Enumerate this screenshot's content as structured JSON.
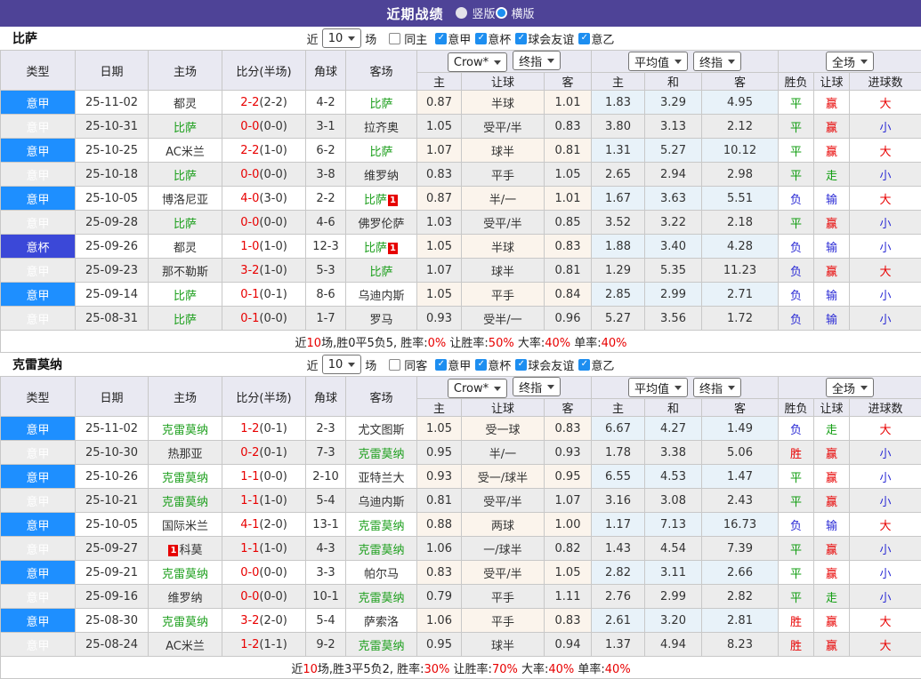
{
  "titlebar": {
    "title": "近期战绩",
    "radios": [
      {
        "label": "竖版",
        "selected": false
      },
      {
        "label": "横版",
        "selected": true
      }
    ]
  },
  "filters_common": {
    "near": "近",
    "count": "10",
    "games": "场",
    "leagues": [
      "意甲",
      "意杯",
      "球会友谊",
      "意乙"
    ]
  },
  "table_header": {
    "type": "类型",
    "date": "日期",
    "home": "主场",
    "score": "比分(半场)",
    "corner": "角球",
    "away": "客场",
    "book_select": "Crow*",
    "final_select": "终指",
    "avg_select": "平均值",
    "full_select": "全场",
    "sub_home": "主",
    "sub_handicap": "让球",
    "sub_away": "客",
    "sub_avg_home": "主",
    "sub_avg_draw": "和",
    "sub_avg_away": "客",
    "sub_wdl": "胜负",
    "sub_let": "让球",
    "sub_goals": "进球数"
  },
  "colors": {
    "topbar_purple": "#4e4397",
    "league_blue": "#1e8fff",
    "cup_blue": "#3b48d8",
    "subject_green": "#1fa01f",
    "win_red": "#e80000",
    "draw_green": "#0f9d0f",
    "lose_blue": "#2b2bd5",
    "avg_col_bg": "#e8f2f9",
    "badge_red": "#e60000"
  },
  "sections": [
    {
      "team": "比萨",
      "same_label": "同主",
      "rows": [
        {
          "league": "意甲",
          "cup": false,
          "date": "25-11-02",
          "home": {
            "name": "都灵",
            "subject": false
          },
          "ft": "2-2",
          "ht": "(2-2)",
          "corner": "4-2",
          "away": {
            "name": "比萨",
            "subject": true
          },
          "crown": [
            "0.87",
            "半球",
            "1.01"
          ],
          "avg": [
            "1.83",
            "3.29",
            "4.95"
          ],
          "res": [
            [
              "平",
              "g"
            ],
            [
              "赢",
              "r"
            ],
            [
              "大",
              "r"
            ]
          ]
        },
        {
          "league": "意甲",
          "cup": false,
          "date": "25-10-31",
          "home": {
            "name": "比萨",
            "subject": true
          },
          "ft": "0-0",
          "ht": "(0-0)",
          "corner": "3-1",
          "away": {
            "name": "拉齐奥",
            "subject": false
          },
          "crown": [
            "1.05",
            "受平/半",
            "0.83"
          ],
          "avg": [
            "3.80",
            "3.13",
            "2.12"
          ],
          "res": [
            [
              "平",
              "g"
            ],
            [
              "赢",
              "r"
            ],
            [
              "小",
              "b"
            ]
          ]
        },
        {
          "league": "意甲",
          "cup": false,
          "date": "25-10-25",
          "home": {
            "name": "AC米兰",
            "subject": false
          },
          "ft": "2-2",
          "ht": "(1-0)",
          "corner": "6-2",
          "away": {
            "name": "比萨",
            "subject": true
          },
          "crown": [
            "1.07",
            "球半",
            "0.81"
          ],
          "avg": [
            "1.31",
            "5.27",
            "10.12"
          ],
          "res": [
            [
              "平",
              "g"
            ],
            [
              "赢",
              "r"
            ],
            [
              "大",
              "r"
            ]
          ]
        },
        {
          "league": "意甲",
          "cup": false,
          "date": "25-10-18",
          "home": {
            "name": "比萨",
            "subject": true
          },
          "ft": "0-0",
          "ht": "(0-0)",
          "corner": "3-8",
          "away": {
            "name": "维罗纳",
            "subject": false
          },
          "crown": [
            "0.83",
            "平手",
            "1.05"
          ],
          "avg": [
            "2.65",
            "2.94",
            "2.98"
          ],
          "res": [
            [
              "平",
              "g"
            ],
            [
              "走",
              "g"
            ],
            [
              "小",
              "b"
            ]
          ]
        },
        {
          "league": "意甲",
          "cup": false,
          "date": "25-10-05",
          "home": {
            "name": "博洛尼亚",
            "subject": false
          },
          "ft": "4-0",
          "ht": "(3-0)",
          "corner": "2-2",
          "away": {
            "name": "比萨",
            "subject": true,
            "badge": "1",
            "badge_side": "after"
          },
          "crown": [
            "0.87",
            "半/一",
            "1.01"
          ],
          "avg": [
            "1.67",
            "3.63",
            "5.51"
          ],
          "res": [
            [
              "负",
              "b"
            ],
            [
              "输",
              "b"
            ],
            [
              "大",
              "r"
            ]
          ]
        },
        {
          "league": "意甲",
          "cup": false,
          "date": "25-09-28",
          "home": {
            "name": "比萨",
            "subject": true
          },
          "ft": "0-0",
          "ht": "(0-0)",
          "corner": "4-6",
          "away": {
            "name": "佛罗伦萨",
            "subject": false
          },
          "crown": [
            "1.03",
            "受平/半",
            "0.85"
          ],
          "avg": [
            "3.52",
            "3.22",
            "2.18"
          ],
          "res": [
            [
              "平",
              "g"
            ],
            [
              "赢",
              "r"
            ],
            [
              "小",
              "b"
            ]
          ]
        },
        {
          "league": "意杯",
          "cup": true,
          "date": "25-09-26",
          "home": {
            "name": "都灵",
            "subject": false
          },
          "ft": "1-0",
          "ht": "(1-0)",
          "corner": "12-3",
          "away": {
            "name": "比萨",
            "subject": true,
            "badge": "1",
            "badge_side": "after"
          },
          "crown": [
            "1.05",
            "半球",
            "0.83"
          ],
          "avg": [
            "1.88",
            "3.40",
            "4.28"
          ],
          "res": [
            [
              "负",
              "b"
            ],
            [
              "输",
              "b"
            ],
            [
              "小",
              "b"
            ]
          ]
        },
        {
          "league": "意甲",
          "cup": false,
          "date": "25-09-23",
          "home": {
            "name": "那不勒斯",
            "subject": false
          },
          "ft": "3-2",
          "ht": "(1-0)",
          "corner": "5-3",
          "away": {
            "name": "比萨",
            "subject": true
          },
          "crown": [
            "1.07",
            "球半",
            "0.81"
          ],
          "avg": [
            "1.29",
            "5.35",
            "11.23"
          ],
          "res": [
            [
              "负",
              "b"
            ],
            [
              "赢",
              "r"
            ],
            [
              "大",
              "r"
            ]
          ]
        },
        {
          "league": "意甲",
          "cup": false,
          "date": "25-09-14",
          "home": {
            "name": "比萨",
            "subject": true
          },
          "ft": "0-1",
          "ht": "(0-1)",
          "corner": "8-6",
          "away": {
            "name": "乌迪内斯",
            "subject": false
          },
          "crown": [
            "1.05",
            "平手",
            "0.84"
          ],
          "avg": [
            "2.85",
            "2.99",
            "2.71"
          ],
          "res": [
            [
              "负",
              "b"
            ],
            [
              "输",
              "b"
            ],
            [
              "小",
              "b"
            ]
          ]
        },
        {
          "league": "意甲",
          "cup": false,
          "date": "25-08-31",
          "home": {
            "name": "比萨",
            "subject": true
          },
          "ft": "0-1",
          "ht": "(0-0)",
          "corner": "1-7",
          "away": {
            "name": "罗马",
            "subject": false
          },
          "crown": [
            "0.93",
            "受半/一",
            "0.96"
          ],
          "avg": [
            "5.27",
            "3.56",
            "1.72"
          ],
          "res": [
            [
              "负",
              "b"
            ],
            [
              "输",
              "b"
            ],
            [
              "小",
              "b"
            ]
          ]
        }
      ],
      "summary": [
        {
          "t": "近"
        },
        {
          "t": "10",
          "red": true
        },
        {
          "t": "场,胜0平5负5, 胜率:"
        },
        {
          "t": "0%",
          "red": true
        },
        {
          "t": " 让胜率:"
        },
        {
          "t": "50%",
          "red": true
        },
        {
          "t": " 大率:"
        },
        {
          "t": "40%",
          "red": true
        },
        {
          "t": " 单率:"
        },
        {
          "t": "40%",
          "red": true
        }
      ]
    },
    {
      "team": "克雷莫纳",
      "same_label": "同客",
      "rows": [
        {
          "league": "意甲",
          "cup": false,
          "date": "25-11-02",
          "home": {
            "name": "克雷莫纳",
            "subject": true
          },
          "ft": "1-2",
          "ht": "(0-1)",
          "corner": "2-3",
          "away": {
            "name": "尤文图斯",
            "subject": false
          },
          "crown": [
            "1.05",
            "受一球",
            "0.83"
          ],
          "avg": [
            "6.67",
            "4.27",
            "1.49"
          ],
          "res": [
            [
              "负",
              "b"
            ],
            [
              "走",
              "g"
            ],
            [
              "大",
              "r"
            ]
          ]
        },
        {
          "league": "意甲",
          "cup": false,
          "date": "25-10-30",
          "home": {
            "name": "热那亚",
            "subject": false
          },
          "ft": "0-2",
          "ht": "(0-1)",
          "corner": "7-3",
          "away": {
            "name": "克雷莫纳",
            "subject": true
          },
          "crown": [
            "0.95",
            "半/一",
            "0.93"
          ],
          "avg": [
            "1.78",
            "3.38",
            "5.06"
          ],
          "res": [
            [
              "胜",
              "r"
            ],
            [
              "赢",
              "r"
            ],
            [
              "小",
              "b"
            ]
          ]
        },
        {
          "league": "意甲",
          "cup": false,
          "date": "25-10-26",
          "home": {
            "name": "克雷莫纳",
            "subject": true
          },
          "ft": "1-1",
          "ht": "(0-0)",
          "corner": "2-10",
          "away": {
            "name": "亚特兰大",
            "subject": false
          },
          "crown": [
            "0.93",
            "受一/球半",
            "0.95"
          ],
          "avg": [
            "6.55",
            "4.53",
            "1.47"
          ],
          "res": [
            [
              "平",
              "g"
            ],
            [
              "赢",
              "r"
            ],
            [
              "小",
              "b"
            ]
          ]
        },
        {
          "league": "意甲",
          "cup": false,
          "date": "25-10-21",
          "home": {
            "name": "克雷莫纳",
            "subject": true
          },
          "ft": "1-1",
          "ht": "(1-0)",
          "corner": "5-4",
          "away": {
            "name": "乌迪内斯",
            "subject": false
          },
          "crown": [
            "0.81",
            "受平/半",
            "1.07"
          ],
          "avg": [
            "3.16",
            "3.08",
            "2.43"
          ],
          "res": [
            [
              "平",
              "g"
            ],
            [
              "赢",
              "r"
            ],
            [
              "小",
              "b"
            ]
          ]
        },
        {
          "league": "意甲",
          "cup": false,
          "date": "25-10-05",
          "home": {
            "name": "国际米兰",
            "subject": false
          },
          "ft": "4-1",
          "ht": "(2-0)",
          "corner": "13-1",
          "away": {
            "name": "克雷莫纳",
            "subject": true
          },
          "crown": [
            "0.88",
            "两球",
            "1.00"
          ],
          "avg": [
            "1.17",
            "7.13",
            "16.73"
          ],
          "res": [
            [
              "负",
              "b"
            ],
            [
              "输",
              "b"
            ],
            [
              "大",
              "r"
            ]
          ]
        },
        {
          "league": "意甲",
          "cup": false,
          "date": "25-09-27",
          "home": {
            "name": "科莫",
            "subject": false,
            "badge": "1",
            "badge_side": "before"
          },
          "ft": "1-1",
          "ht": "(1-0)",
          "corner": "4-3",
          "away": {
            "name": "克雷莫纳",
            "subject": true
          },
          "crown": [
            "1.06",
            "一/球半",
            "0.82"
          ],
          "avg": [
            "1.43",
            "4.54",
            "7.39"
          ],
          "res": [
            [
              "平",
              "g"
            ],
            [
              "赢",
              "r"
            ],
            [
              "小",
              "b"
            ]
          ]
        },
        {
          "league": "意甲",
          "cup": false,
          "date": "25-09-21",
          "home": {
            "name": "克雷莫纳",
            "subject": true
          },
          "ft": "0-0",
          "ht": "(0-0)",
          "corner": "3-3",
          "away": {
            "name": "帕尔马",
            "subject": false
          },
          "crown": [
            "0.83",
            "受平/半",
            "1.05"
          ],
          "avg": [
            "2.82",
            "3.11",
            "2.66"
          ],
          "res": [
            [
              "平",
              "g"
            ],
            [
              "赢",
              "r"
            ],
            [
              "小",
              "b"
            ]
          ]
        },
        {
          "league": "意甲",
          "cup": false,
          "date": "25-09-16",
          "home": {
            "name": "维罗纳",
            "subject": false
          },
          "ft": "0-0",
          "ht": "(0-0)",
          "corner": "10-1",
          "away": {
            "name": "克雷莫纳",
            "subject": true
          },
          "crown": [
            "0.79",
            "平手",
            "1.11"
          ],
          "avg": [
            "2.76",
            "2.99",
            "2.82"
          ],
          "res": [
            [
              "平",
              "g"
            ],
            [
              "走",
              "g"
            ],
            [
              "小",
              "b"
            ]
          ]
        },
        {
          "league": "意甲",
          "cup": false,
          "date": "25-08-30",
          "home": {
            "name": "克雷莫纳",
            "subject": true
          },
          "ft": "3-2",
          "ht": "(2-0)",
          "corner": "5-4",
          "away": {
            "name": "萨索洛",
            "subject": false
          },
          "crown": [
            "1.06",
            "平手",
            "0.83"
          ],
          "avg": [
            "2.61",
            "3.20",
            "2.81"
          ],
          "res": [
            [
              "胜",
              "r"
            ],
            [
              "赢",
              "r"
            ],
            [
              "大",
              "r"
            ]
          ]
        },
        {
          "league": "意甲",
          "cup": false,
          "date": "25-08-24",
          "home": {
            "name": "AC米兰",
            "subject": false
          },
          "ft": "1-2",
          "ht": "(1-1)",
          "corner": "9-2",
          "away": {
            "name": "克雷莫纳",
            "subject": true
          },
          "crown": [
            "0.95",
            "球半",
            "0.94"
          ],
          "avg": [
            "1.37",
            "4.94",
            "8.23"
          ],
          "res": [
            [
              "胜",
              "r"
            ],
            [
              "赢",
              "r"
            ],
            [
              "大",
              "r"
            ]
          ]
        }
      ],
      "summary": [
        {
          "t": "近"
        },
        {
          "t": "10",
          "red": true
        },
        {
          "t": "场,胜3平5负2, 胜率:"
        },
        {
          "t": "30%",
          "red": true
        },
        {
          "t": " 让胜率:"
        },
        {
          "t": "70%",
          "red": true
        },
        {
          "t": " 大率:"
        },
        {
          "t": "40%",
          "red": true
        },
        {
          "t": " 单率:"
        },
        {
          "t": "40%",
          "red": true
        }
      ]
    }
  ]
}
